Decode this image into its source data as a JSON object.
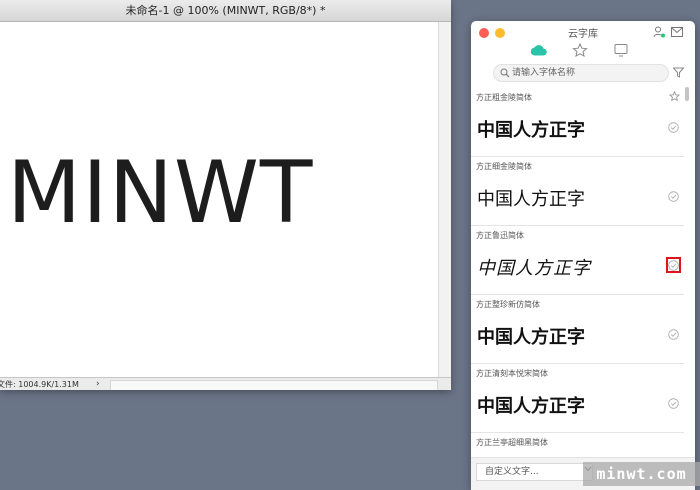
{
  "document": {
    "title": "未命名-1 @ 100% (MINWT, RGB/8*) *",
    "canvas_text": "MINWT",
    "status_text": "文件: 1004.9K/1.31M",
    "status_arrow": "›"
  },
  "panel": {
    "title": "云字库",
    "tabs": [
      {
        "icon": "cloud-icon",
        "active_color": "#2cc4a8"
      },
      {
        "icon": "star-icon"
      },
      {
        "icon": "monitor-icon"
      }
    ],
    "search": {
      "placeholder": "请输入字体名称"
    },
    "fonts": [
      {
        "name": "方正粗金陵简体",
        "sample": "中国人方正字"
      },
      {
        "name": "方正细金陵简体",
        "sample": "中国人方正字"
      },
      {
        "name": "方正鲁迅简体",
        "sample": "中国人方正字"
      },
      {
        "name": "方正整珍新仿简体",
        "sample": "中国人方正字"
      },
      {
        "name": "方正清刻本悦宋简体",
        "sample": "中国人方正字"
      },
      {
        "name": "方正兰亭超细黑简体",
        "sample": ""
      }
    ],
    "custom_text": {
      "placeholder": "自定义文字..."
    },
    "highlight_color": "#e0141b"
  },
  "watermark": "minwt.com"
}
